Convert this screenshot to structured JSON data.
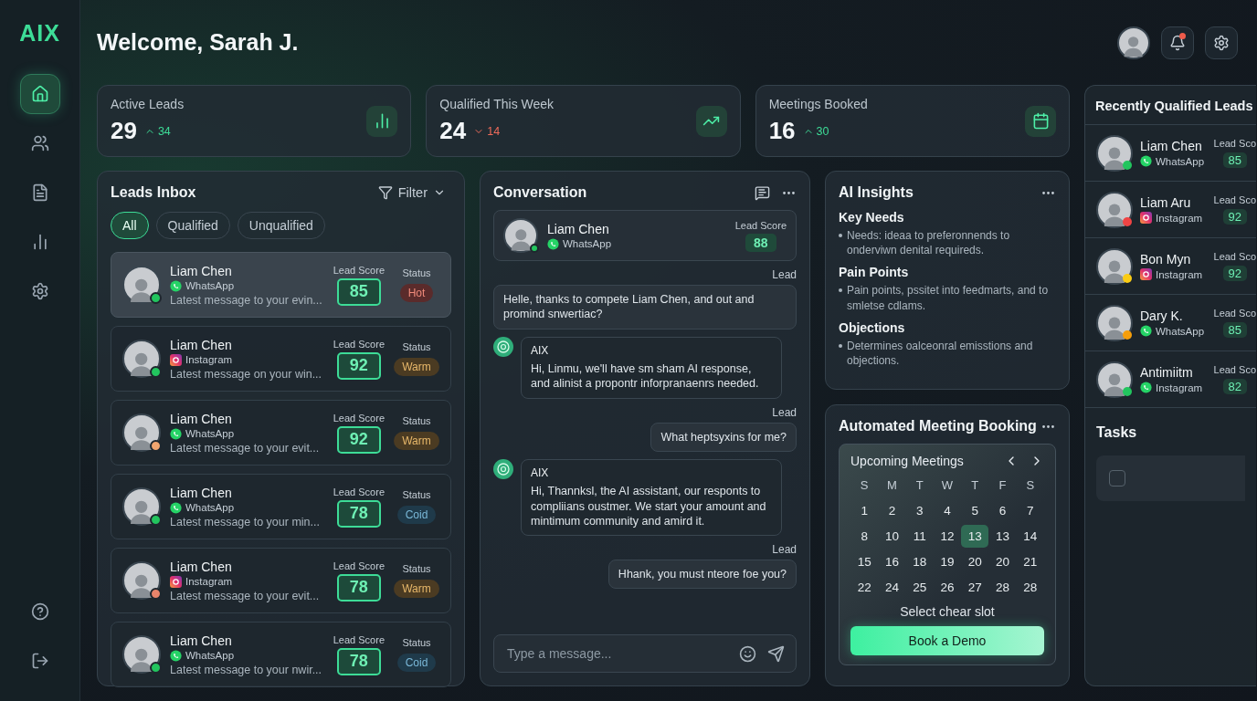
{
  "brand": "AIX",
  "nav": [
    {
      "kind": "home",
      "selected": true
    },
    {
      "kind": "users",
      "selected": false
    },
    {
      "kind": "document",
      "selected": false
    },
    {
      "kind": "chart",
      "selected": false
    },
    {
      "kind": "settings",
      "selected": false
    }
  ],
  "nav_bottom": [
    {
      "kind": "help",
      "selected": false
    },
    {
      "kind": "logout",
      "selected": false
    }
  ],
  "header": {
    "title": "Welcome, Sarah J.",
    "notification": true
  },
  "stats": [
    {
      "label": "Active Leads",
      "value": "29",
      "change": "34",
      "up": true,
      "kind": "bars"
    },
    {
      "label": "Qualified This Week",
      "value": "24",
      "change": "14",
      "up": false,
      "kind": "trend"
    },
    {
      "label": "Meetings Booked",
      "value": "16",
      "change": "30",
      "up": true,
      "kind": "calendar"
    }
  ],
  "inbox": {
    "title": "Leads Inbox",
    "filter": "Filter",
    "tabs": [
      {
        "label": "All",
        "selected": true
      },
      {
        "label": "Qualified",
        "selected": false
      },
      {
        "label": "Unqualified",
        "selected": false
      }
    ],
    "leads": [
      {
        "name": "Liam Chen",
        "channel": {
          "kind": "whatsapp",
          "label": "WhatsApp"
        },
        "message": "Latest message to your evin...",
        "score_label": "Lead Score",
        "score": "85",
        "status_label": "Status",
        "status": {
          "kind": "hot",
          "label": "Hot"
        },
        "color": "#22c55e",
        "selected": true
      },
      {
        "name": "Liam Chen",
        "channel": {
          "kind": "instagram",
          "label": "Instagram"
        },
        "message": "Latest message on your win...",
        "score_label": "Lead Score",
        "score": "92",
        "status_label": "Status",
        "status": {
          "kind": "warm",
          "label": "Warm"
        },
        "color": "#22c55e",
        "selected": false
      },
      {
        "name": "Liam Chen",
        "channel": {
          "kind": "whatsapp",
          "label": "WhatsApp"
        },
        "message": "Latest message to your evit...",
        "score_label": "Lead Score",
        "score": "92",
        "status_label": "Status",
        "status": {
          "kind": "warm",
          "label": "Warm"
        },
        "color": "#f0a56f",
        "selected": false
      },
      {
        "name": "Liam Chen",
        "channel": {
          "kind": "whatsapp",
          "label": "WhatsApp"
        },
        "message": "Latest message to your min...",
        "score_label": "Lead Score",
        "score": "78",
        "status_label": "Status",
        "status": {
          "kind": "cold",
          "label": "Coid"
        },
        "color": "#22c55e",
        "selected": false
      },
      {
        "name": "Liam Chen",
        "channel": {
          "kind": "instagram",
          "label": "Instagram"
        },
        "message": "Latest message to your evit...",
        "score_label": "Lead Score",
        "score": "78",
        "status_label": "Status",
        "status": {
          "kind": "warm",
          "label": "Warm"
        },
        "color": "#e8846b",
        "selected": false
      },
      {
        "name": "Liam Chen",
        "channel": {
          "kind": "whatsapp",
          "label": "WhatsApp"
        },
        "message": "Latest message to your nwir...",
        "score_label": "Lead Score",
        "score": "78",
        "status_label": "Status",
        "status": {
          "kind": "cold",
          "label": "Coid"
        },
        "color": "#22c55e",
        "selected": false
      }
    ]
  },
  "conversation": {
    "title": "Conversation",
    "contact": {
      "name": "Liam Chen",
      "channel": {
        "kind": "whatsapp",
        "label": "WhatsApp"
      },
      "score_label": "Lead Score",
      "score": "88"
    },
    "messages": [
      {
        "kind": "lead",
        "sender": "Lead",
        "text": "Helle, thanks to compete Liam Chen, and out and promind snwertiac?"
      },
      {
        "kind": "ai",
        "sender": "AIX",
        "text": "Hi, Linmu, we'll have sm sham AI response, and alinist a propontr inforpranaenrs needed."
      },
      {
        "kind": "lead",
        "sender": "Lead",
        "text": "What heptsyxins for me?"
      },
      {
        "kind": "ai",
        "sender": "AIX",
        "text": "Hi, Thannksl, the AI assistant, our responts to compliians oustmer. We start your amount and mintimum community and amird it."
      },
      {
        "kind": "lead",
        "sender": "Lead",
        "text": "Hhank, you must nteore foe you?"
      }
    ],
    "input": {
      "placeholder": "Type a message..."
    }
  },
  "insights": {
    "title": "AI Insights",
    "sections": [
      {
        "heading": "Key Needs",
        "text": "Needs: ideaa to preferonnends to onderviwn denital requireds."
      },
      {
        "heading": "Pain Points",
        "text": "Pain points, pssitet into feedmarts, and to smletse cdlams."
      },
      {
        "heading": "Objections",
        "text": "Determines oalceonral emisstions and objections."
      }
    ]
  },
  "booking": {
    "title": "Automated Meeting Booking",
    "calendar": {
      "title": "Upcoming Meetings",
      "weekdays": [
        "S",
        "M",
        "T",
        "W",
        "T",
        "F",
        "S"
      ],
      "days": [
        {
          "label": "1",
          "selected": false
        },
        {
          "label": "2",
          "selected": false
        },
        {
          "label": "3",
          "selected": false
        },
        {
          "label": "4",
          "selected": false
        },
        {
          "label": "5",
          "selected": false
        },
        {
          "label": "6",
          "selected": false
        },
        {
          "label": "7",
          "selected": false
        },
        {
          "label": "8",
          "selected": false
        },
        {
          "label": "10",
          "selected": false
        },
        {
          "label": "11",
          "selected": false
        },
        {
          "label": "12",
          "selected": false
        },
        {
          "label": "13",
          "selected": true
        },
        {
          "label": "13",
          "selected": false
        },
        {
          "label": "14",
          "selected": false
        },
        {
          "label": "15",
          "selected": false
        },
        {
          "label": "16",
          "selected": false
        },
        {
          "label": "18",
          "selected": false
        },
        {
          "label": "19",
          "selected": false
        },
        {
          "label": "20",
          "selected": false
        },
        {
          "label": "20",
          "selected": false
        },
        {
          "label": "21",
          "selected": false
        },
        {
          "label": "22",
          "selected": false
        },
        {
          "label": "24",
          "selected": false
        },
        {
          "label": "25",
          "selected": false
        },
        {
          "label": "26",
          "selected": false
        },
        {
          "label": "27",
          "selected": false
        },
        {
          "label": "28",
          "selected": false
        },
        {
          "label": "28",
          "selected": false
        }
      ]
    },
    "hint": "Select chear slot",
    "button": "Book a Demo"
  },
  "recent": {
    "title": "Recently Qualified Leads",
    "leads": [
      {
        "name": "Liam Chen",
        "channel": {
          "kind": "whatsapp",
          "label": "WhatsApp"
        },
        "score_label": "Lead Sco",
        "score": "85",
        "color": "#22c55e"
      },
      {
        "name": "Liam Aru",
        "channel": {
          "kind": "instagram",
          "label": "Instagram"
        },
        "score_label": "Lead Sco",
        "score": "92",
        "color": "#ef4444"
      },
      {
        "name": "Bon Myn",
        "channel": {
          "kind": "instagram",
          "label": "Instagram"
        },
        "score_label": "Lead Sco",
        "score": "92",
        "color": "#facc15"
      },
      {
        "name": "Dary K.",
        "channel": {
          "kind": "whatsapp",
          "label": "WhatsApp"
        },
        "score_label": "Lead Sco",
        "score": "85",
        "color": "#f59e0b"
      },
      {
        "name": "Antimiitm",
        "channel": {
          "kind": "whatsapp",
          "label": "Instagram"
        },
        "score_label": "Lead Sco",
        "score": "82",
        "color": "#22c55e"
      }
    ]
  },
  "tasks": {
    "title": "Tasks",
    "items": [
      {
        "checked": false
      }
    ]
  }
}
